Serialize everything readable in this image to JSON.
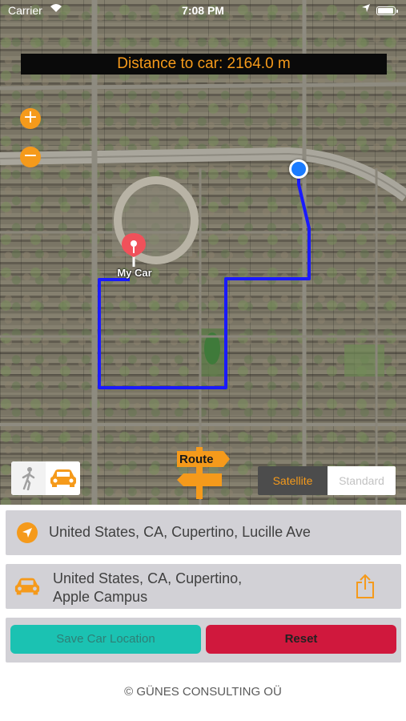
{
  "status_bar": {
    "carrier": "Carrier",
    "time": "7:08 PM"
  },
  "map": {
    "distance_text": "Distance to car: 2164.0 m",
    "zoom_in_label": "+",
    "zoom_out_label": "−",
    "car_pin_label": "My Car",
    "route_sign_label": "Route",
    "route_color": "#1a1aff",
    "map_type": {
      "options": [
        "Satellite",
        "Standard"
      ],
      "selected": "Satellite"
    },
    "transport_modes": {
      "options": [
        "walk-icon",
        "car-icon"
      ],
      "selected": "car-icon"
    }
  },
  "fields": {
    "current_location": "United States, CA, Cupertino, Lucille Ave",
    "car_location_line1": "United States, CA, Cupertino,",
    "car_location_line2": "Apple Campus"
  },
  "buttons": {
    "save": "Save Car Location",
    "reset": "Reset"
  },
  "footer": "© GÜNES CONSULTING OÜ",
  "colors": {
    "accent": "#f59a1b",
    "save": "#1bc2b2",
    "reset": "#d0183d",
    "user_dot": "#1a7bff"
  }
}
